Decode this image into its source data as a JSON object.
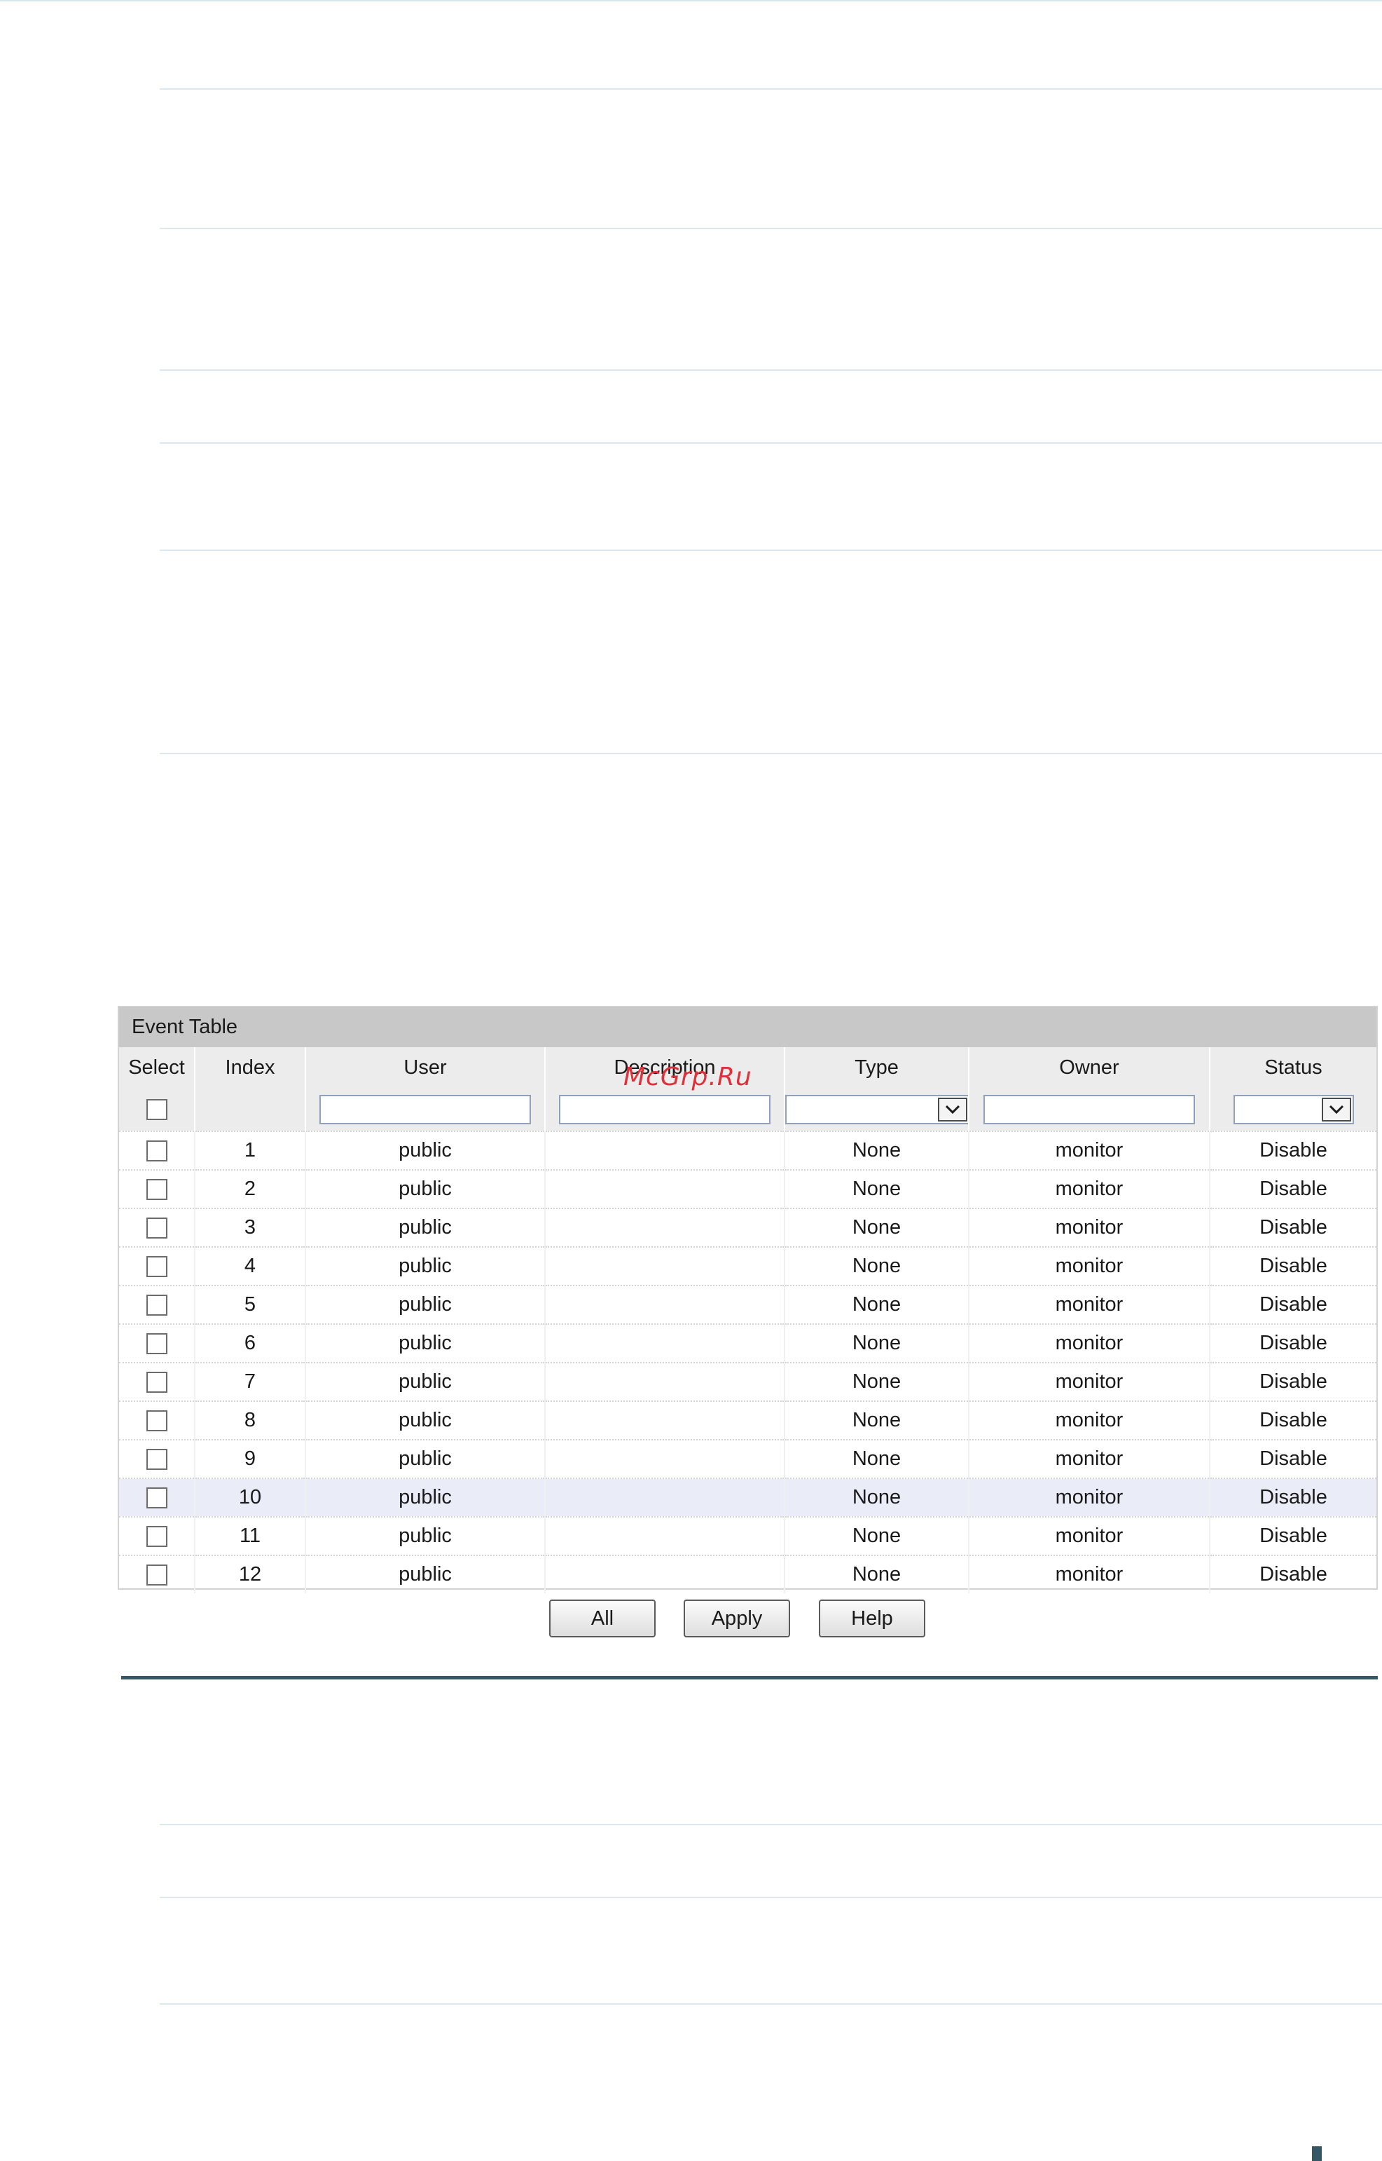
{
  "event_table": {
    "title": "Event Table",
    "columns": [
      "Select",
      "Index",
      "User",
      "Description",
      "Type",
      "Owner",
      "Status"
    ],
    "rows": [
      {
        "index": "1",
        "user": "public",
        "description": "",
        "type": "None",
        "owner": "monitor",
        "status": "Disable"
      },
      {
        "index": "2",
        "user": "public",
        "description": "",
        "type": "None",
        "owner": "monitor",
        "status": "Disable"
      },
      {
        "index": "3",
        "user": "public",
        "description": "",
        "type": "None",
        "owner": "monitor",
        "status": "Disable"
      },
      {
        "index": "4",
        "user": "public",
        "description": "",
        "type": "None",
        "owner": "monitor",
        "status": "Disable"
      },
      {
        "index": "5",
        "user": "public",
        "description": "",
        "type": "None",
        "owner": "monitor",
        "status": "Disable"
      },
      {
        "index": "6",
        "user": "public",
        "description": "",
        "type": "None",
        "owner": "monitor",
        "status": "Disable"
      },
      {
        "index": "7",
        "user": "public",
        "description": "",
        "type": "None",
        "owner": "monitor",
        "status": "Disable"
      },
      {
        "index": "8",
        "user": "public",
        "description": "",
        "type": "None",
        "owner": "monitor",
        "status": "Disable"
      },
      {
        "index": "9",
        "user": "public",
        "description": "",
        "type": "None",
        "owner": "monitor",
        "status": "Disable"
      },
      {
        "index": "10",
        "user": "public",
        "description": "",
        "type": "None",
        "owner": "monitor",
        "status": "Disable"
      },
      {
        "index": "11",
        "user": "public",
        "description": "",
        "type": "None",
        "owner": "monitor",
        "status": "Disable"
      },
      {
        "index": "12",
        "user": "public",
        "description": "",
        "type": "None",
        "owner": "monitor",
        "status": "Disable"
      }
    ],
    "highlighted_row_index": "10",
    "filter": {
      "user_value": "",
      "description_value": "",
      "type_selected": "",
      "owner_value": "",
      "status_selected": ""
    }
  },
  "buttons": {
    "all": "All",
    "apply": "Apply",
    "help": "Help"
  },
  "watermark": "McGrp.Ru",
  "colors": {
    "title_bar": "#c8c8c8",
    "header_bg": "#ececec",
    "highlight_row": "#eaedf8",
    "separator_rule": "#365766",
    "watermark": "#e0303a"
  }
}
